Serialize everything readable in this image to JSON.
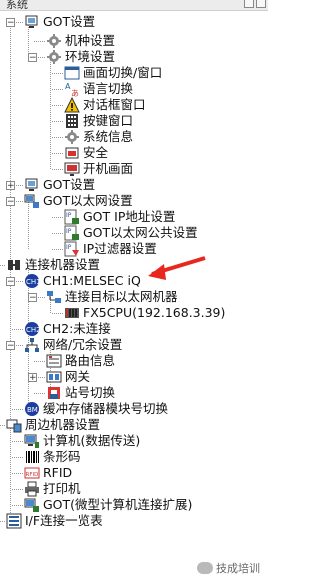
{
  "window": {
    "title": "系统"
  },
  "tree": {
    "items": [
      {
        "id": "got-settings",
        "label": "GOT设置",
        "icon": "got-settings-icon",
        "toggle": "-"
      },
      {
        "id": "model-settings",
        "label": "机种设置",
        "icon": "gear-icon"
      },
      {
        "id": "env-settings",
        "label": "环境设置",
        "icon": "gear-icon",
        "toggle": "-"
      },
      {
        "id": "screen-switch",
        "label": "画面切换/窗口",
        "icon": "window-icon"
      },
      {
        "id": "language-switch",
        "label": "语言切换",
        "icon": "language-icon"
      },
      {
        "id": "dialog-window",
        "label": "对话框窗口",
        "icon": "warning-icon"
      },
      {
        "id": "key-window",
        "label": "按键窗口",
        "icon": "keypad-icon"
      },
      {
        "id": "system-info",
        "label": "系统信息",
        "icon": "gear-icon"
      },
      {
        "id": "security",
        "label": "安全",
        "icon": "lock-icon"
      },
      {
        "id": "startup-screen",
        "label": "开机画面",
        "icon": "monitor-icon"
      },
      {
        "id": "got-settings-2",
        "label": "GOT设置",
        "icon": "got-settings-icon",
        "toggle": "+"
      },
      {
        "id": "got-ethernet",
        "label": "GOT以太网设置",
        "icon": "ethernet-icon",
        "toggle": "-"
      },
      {
        "id": "got-ip",
        "label": "GOT IP地址设置",
        "icon": "ip-icon"
      },
      {
        "id": "got-ethernet-public",
        "label": "GOT以太网公共设置",
        "icon": "ip-icon"
      },
      {
        "id": "ip-filter",
        "label": "IP过滤器设置",
        "icon": "ip-filter-icon"
      },
      {
        "id": "connected-device",
        "label": "连接机器设置",
        "icon": "connect-icon",
        "toggle": "-"
      },
      {
        "id": "ch1",
        "label": "CH1:MELSEC iQ",
        "icon": "ch1-icon",
        "toggle": "-"
      },
      {
        "id": "conn-target",
        "label": "连接目标以太网机器",
        "icon": "network-icon",
        "toggle": "-"
      },
      {
        "id": "fx5cpu",
        "label": "FX5CPU(192.168.3.39)",
        "icon": "plc-icon"
      },
      {
        "id": "ch2",
        "label": "CH2:未连接",
        "icon": "ch2-icon"
      },
      {
        "id": "gateway-redundancy",
        "label": "网络/冗余设置",
        "icon": "network-tree-icon",
        "toggle": "-"
      },
      {
        "id": "routing-info",
        "label": "路由信息",
        "icon": "routing-icon"
      },
      {
        "id": "gateway",
        "label": "网关",
        "icon": "gateway-icon",
        "toggle": "+"
      },
      {
        "id": "station-switch",
        "label": "站号切换",
        "icon": "station-icon"
      },
      {
        "id": "buffer-block",
        "label": "缓冲存储器模块号切换",
        "icon": "buffer-icon"
      },
      {
        "id": "peripheral",
        "label": "周边机器设置",
        "icon": "peripheral-icon",
        "toggle": "-"
      },
      {
        "id": "computer",
        "label": "计算机(数据传送)",
        "icon": "computer-icon"
      },
      {
        "id": "barcode",
        "label": "条形码",
        "icon": "barcode-icon"
      },
      {
        "id": "rfid",
        "label": "RFID",
        "icon": "rfid-icon"
      },
      {
        "id": "printer",
        "label": "打印机",
        "icon": "printer-icon"
      },
      {
        "id": "got-micro",
        "label": "GOT(微型计算机连接扩展)",
        "icon": "got-micro-icon"
      },
      {
        "id": "if-list",
        "label": "I/F连接一览表",
        "icon": "list-icon"
      }
    ]
  },
  "watermark": {
    "text": "技成培训"
  },
  "colors": {
    "arrow": "#e8271e",
    "selected_bg": "#cfe3ff"
  }
}
